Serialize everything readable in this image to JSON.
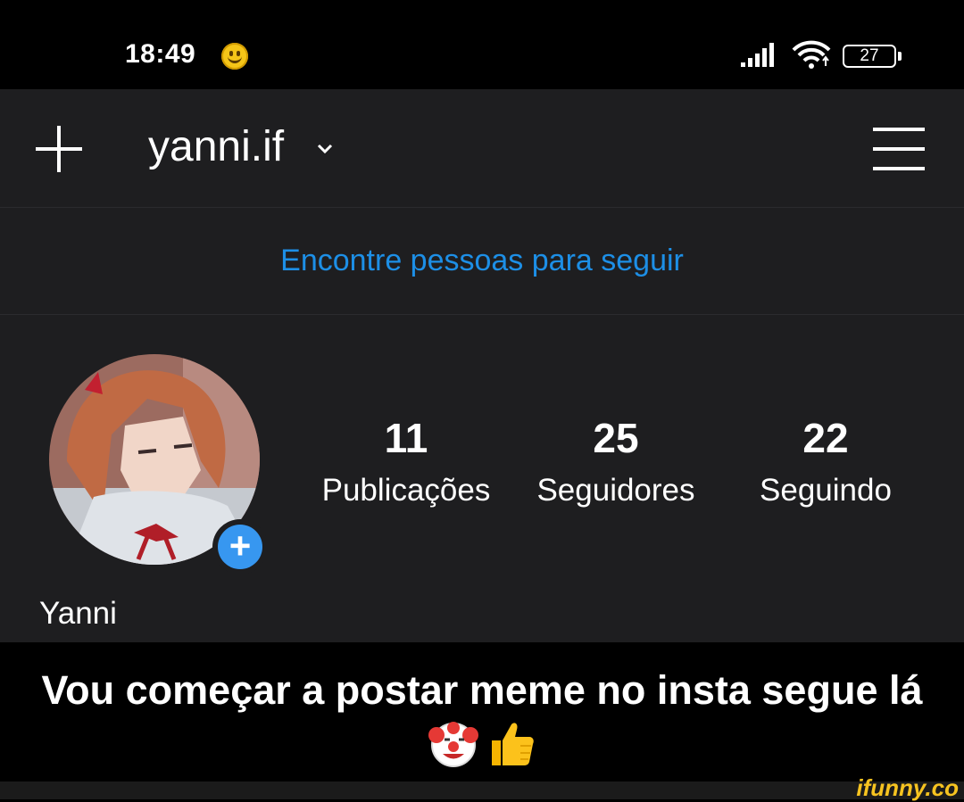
{
  "status_bar": {
    "time": "18:49",
    "battery": "27"
  },
  "header": {
    "username": "yanni.if"
  },
  "banner": {
    "find_people": "Encontre pessoas para seguir"
  },
  "profile": {
    "display_name": "Yanni",
    "stats": [
      {
        "value": "11",
        "label": "Publicações"
      },
      {
        "value": "25",
        "label": "Seguidores"
      },
      {
        "value": "22",
        "label": "Seguindo"
      }
    ]
  },
  "caption": {
    "text": "Vou começar a postar meme no insta segue lá"
  },
  "watermark": "ifunny.co",
  "colors": {
    "accent": "#1d8fe6",
    "background": "#1e1e20",
    "story_add": "#3797f0",
    "watermark": "#f6c320"
  },
  "icons": [
    "smiley-icon",
    "signal-icon",
    "wifi-icon",
    "battery-icon",
    "plus-icon",
    "chevron-down-icon",
    "menu-icon",
    "add-story-icon",
    "clown-emoji-icon",
    "thumbs-up-emoji-icon"
  ]
}
